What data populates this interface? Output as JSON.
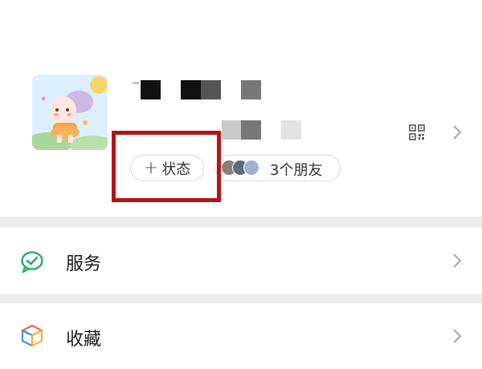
{
  "profile": {
    "status_button": {
      "plus": "+",
      "label": "状态"
    },
    "friends_button": {
      "label": "3个朋友"
    }
  },
  "menu": {
    "items": [
      {
        "label": "服务",
        "icon": "wechat-pay-icon"
      },
      {
        "label": "收藏",
        "icon": "favorites-cube-icon"
      }
    ]
  },
  "colors": {
    "highlight": "#b51414",
    "pay_green": "#2aae67",
    "separator": "#ededed"
  }
}
